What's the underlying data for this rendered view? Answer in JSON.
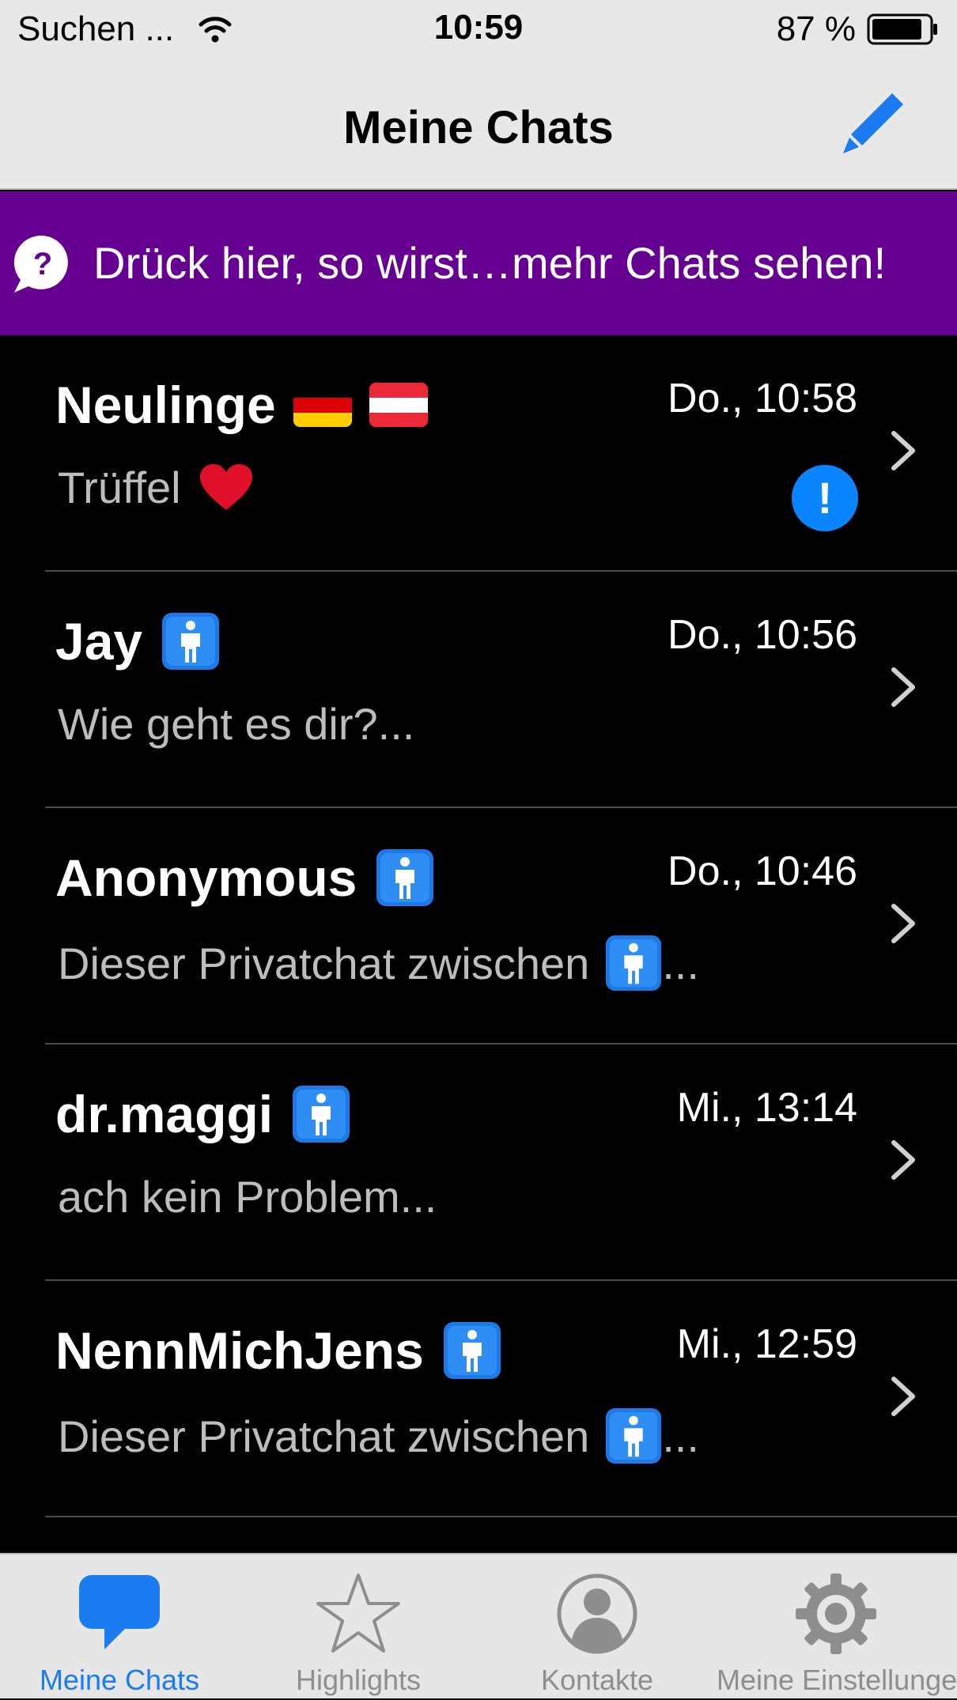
{
  "status_bar": {
    "carrier": "Suchen ...",
    "time": "10:59",
    "battery": "87 %"
  },
  "nav": {
    "title": "Meine Chats",
    "compose_icon": "pencil-icon"
  },
  "banner": {
    "text": "Drück hier, so wirst…mehr Chats sehen!",
    "color": "#650090"
  },
  "chats": [
    {
      "name": "Neulinge",
      "time": "Do., 10:58",
      "preview": "Trüffel",
      "name_icons": [
        "germany-flag-icon",
        "austria-flag-icon"
      ],
      "preview_icon": "heart-icon",
      "alert": "!"
    },
    {
      "name": "Jay",
      "time": "Do., 10:56",
      "preview": "Wie geht es dir?...",
      "name_icons": [
        "man-icon"
      ]
    },
    {
      "name": "Anonymous",
      "time": "Do., 10:46",
      "preview": "Dieser Privatchat zwischen",
      "preview_suffix": "...",
      "name_icons": [
        "man-icon"
      ],
      "preview_icon": "man-icon"
    },
    {
      "name": "dr.maggi",
      "time": "Mi., 13:14",
      "preview": "ach kein Problem...",
      "name_icons": [
        "man-icon"
      ]
    },
    {
      "name": "NennMichJens",
      "time": "Mi., 12:59",
      "preview": "Dieser Privatchat zwischen",
      "preview_suffix": "...",
      "name_icons": [
        "man-icon"
      ],
      "preview_icon": "man-icon"
    }
  ],
  "tabs": [
    {
      "label": "Meine Chats",
      "icon": "chat-bubble-icon",
      "active": true
    },
    {
      "label": "Highlights",
      "icon": "star-icon"
    },
    {
      "label": "Kontakte",
      "icon": "contact-icon"
    },
    {
      "label": "Meine Einstellungen",
      "icon": "gear-icon"
    }
  ],
  "colors": {
    "accent": "#1a7cf0",
    "badge": "#0a84ff"
  }
}
